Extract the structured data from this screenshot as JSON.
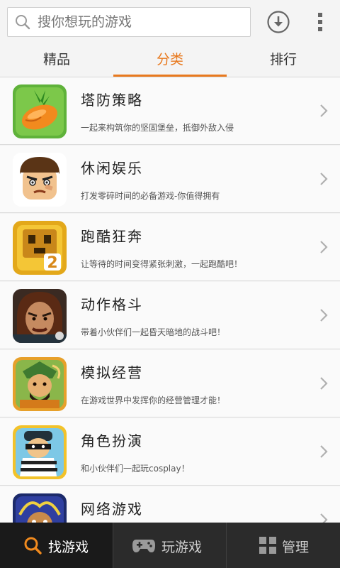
{
  "search": {
    "placeholder": "搜你想玩的游戏",
    "icon": "search-icon"
  },
  "toolbar": {
    "download_icon": "download-icon",
    "menu_icon": "more-vertical-icon"
  },
  "tabs": [
    {
      "label": "精品",
      "active": false
    },
    {
      "label": "分类",
      "active": true
    },
    {
      "label": "排行",
      "active": false
    }
  ],
  "accent_color": "#e8791e",
  "categories": [
    {
      "title": "塔防策略",
      "desc": "一起来构筑你的坚固堡垒，抵御外敌入侵",
      "icon": "carrot-game-icon"
    },
    {
      "title": "休闲娱乐",
      "desc": "打发零碎时间的必备游戏-你值得拥有",
      "icon": "cartoon-face-icon"
    },
    {
      "title": "跑酷狂奔",
      "desc": "让等待的时间变得紧张刺激，一起跑酷吧！",
      "icon": "temple-run-icon"
    },
    {
      "title": "动作格斗",
      "desc": "带着小伙伴们一起昏天暗地的战斗吧！",
      "icon": "warrior-icon"
    },
    {
      "title": "模拟经营",
      "desc": "在游戏世界中发挥你的经营管理才能！",
      "icon": "general-icon"
    },
    {
      "title": "角色扮演",
      "desc": "和小伙伴们一起玩cosplay！",
      "icon": "thief-icon"
    },
    {
      "title": "网络游戏",
      "desc": "",
      "icon": "monkey-king-icon"
    }
  ],
  "bottom_nav": [
    {
      "label": "找游戏",
      "icon": "search-icon",
      "active": true
    },
    {
      "label": "玩游戏",
      "icon": "gamepad-icon",
      "active": false
    },
    {
      "label": "管理",
      "icon": "grid-icon",
      "active": false
    }
  ]
}
